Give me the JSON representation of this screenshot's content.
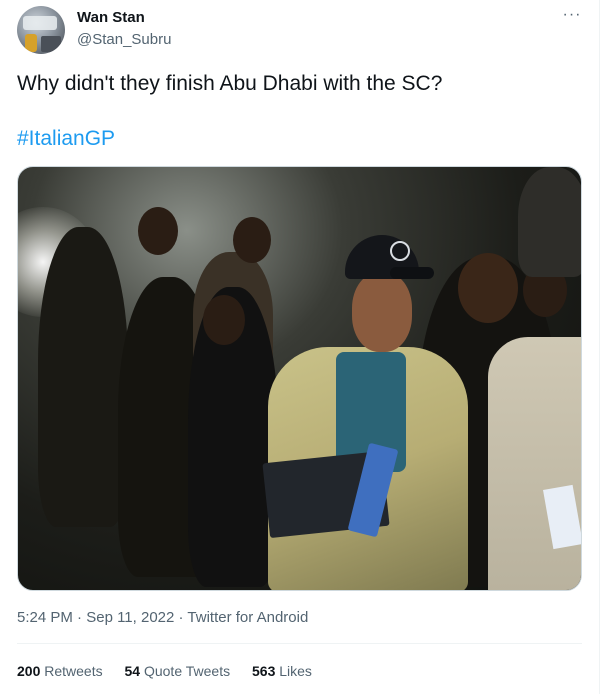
{
  "author": {
    "display_name": "Wan Stan",
    "handle": "@Stan_Subru"
  },
  "more_icon_glyph": "···",
  "tweet": {
    "text": "Why didn't they finish Abu Dhabi with the SC?",
    "hashtag": "#ItalianGP"
  },
  "meta": {
    "time": "5:24 PM",
    "separator1": " · ",
    "date": "Sep 11, 2022",
    "separator2": " · ",
    "source": "Twitter for Android"
  },
  "stats": {
    "retweets_count": "200",
    "retweets_label": "Retweets",
    "quotes_count": "54",
    "quotes_label": "Quote Tweets",
    "likes_count": "563",
    "likes_label": "Likes"
  },
  "colors": {
    "link": "#1d9bf0",
    "secondary_text": "#536471",
    "primary_text": "#0f1419",
    "border": "#cfd9de"
  },
  "icons": {
    "more": "more-horizontal-icon"
  }
}
